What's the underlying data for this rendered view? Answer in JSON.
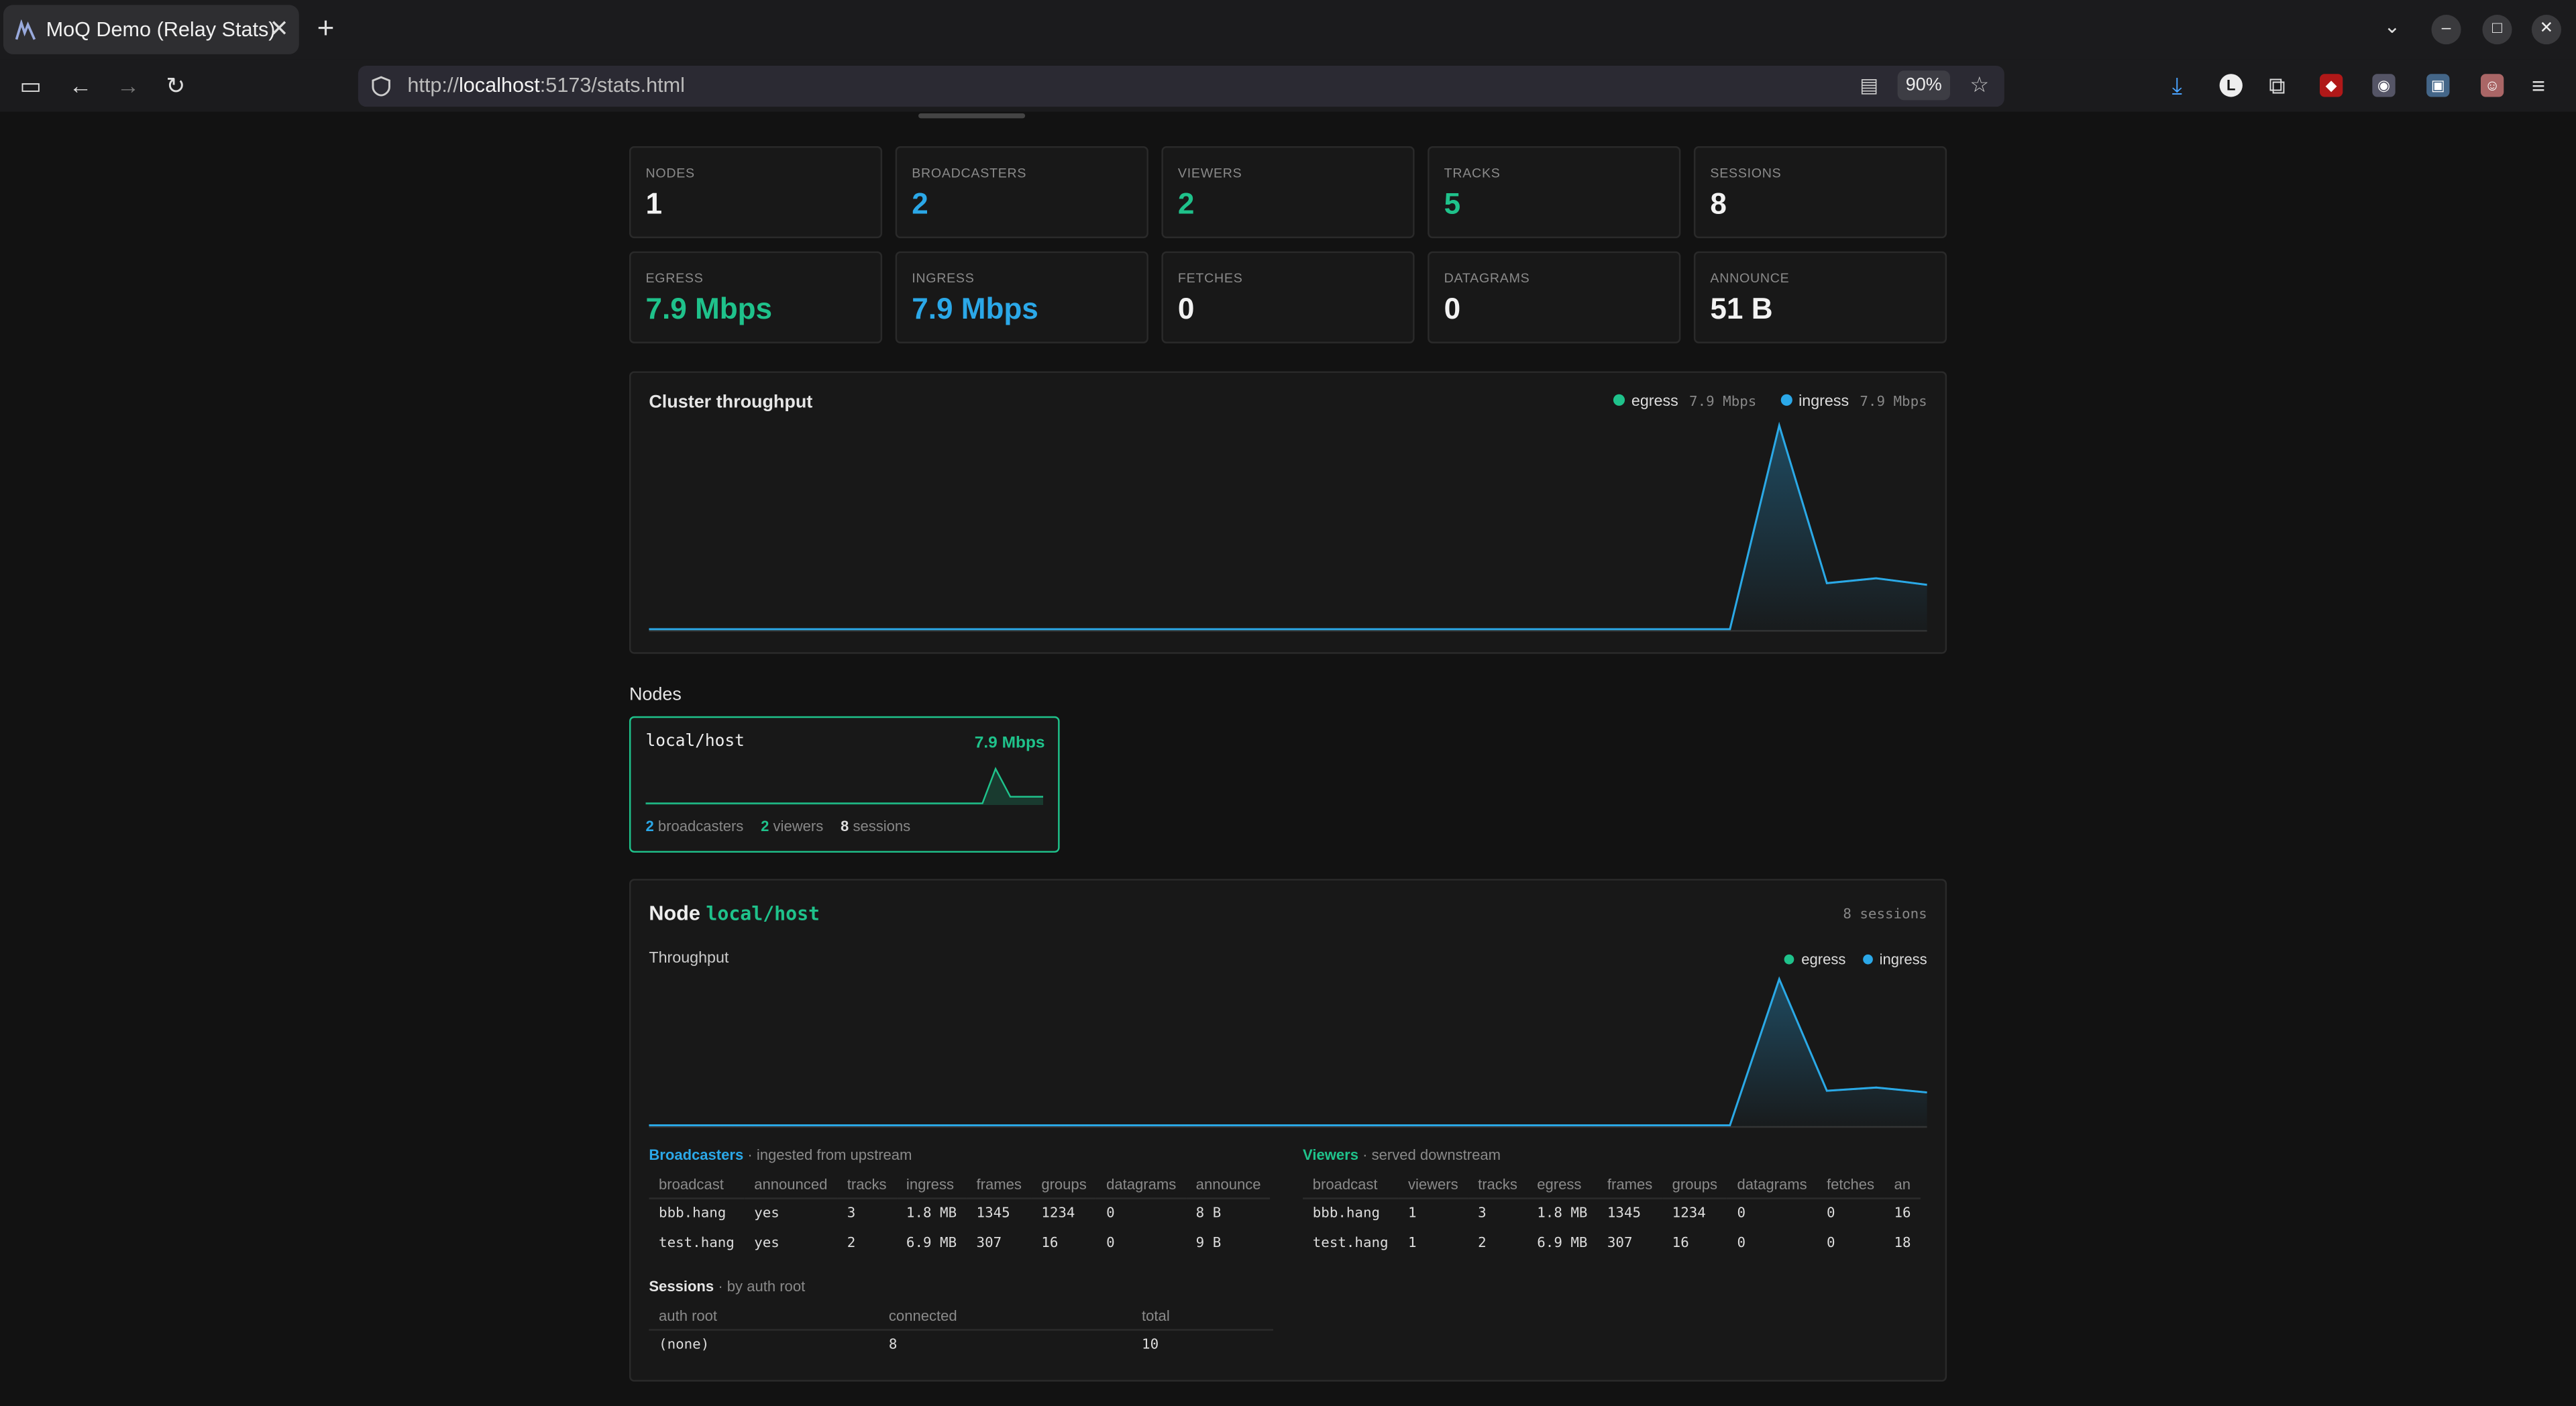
{
  "browser": {
    "tab_title": "MoQ Demo (Relay Stats)",
    "url_prefix": "http://",
    "url_host": "localhost",
    "url_rest": ":5173/stats.html",
    "zoom": "90%"
  },
  "stats_row1": [
    {
      "label": "NODES",
      "value": "1"
    },
    {
      "label": "BROADCASTERS",
      "value": "2"
    },
    {
      "label": "VIEWERS",
      "value": "2"
    },
    {
      "label": "TRACKS",
      "value": "5"
    },
    {
      "label": "SESSIONS",
      "value": "8"
    }
  ],
  "stats_row2": [
    {
      "label": "EGRESS",
      "value": "7.9 Mbps"
    },
    {
      "label": "INGRESS",
      "value": "7.9 Mbps"
    },
    {
      "label": "FETCHES",
      "value": "0"
    },
    {
      "label": "DATAGRAMS",
      "value": "0"
    },
    {
      "label": "ANNOUNCE",
      "value": "51 B"
    }
  ],
  "cluster": {
    "title": "Cluster throughput",
    "legend_egress": "egress",
    "egress_value": "7.9 Mbps",
    "legend_ingress": "ingress",
    "ingress_value": "7.9 Mbps"
  },
  "nodes_section": {
    "title": "Nodes",
    "node_name": "local/host",
    "node_rate": "7.9 Mbps",
    "broadcasters_count": "2",
    "broadcasters_label": "broadcasters",
    "viewers_count": "2",
    "viewers_label": "viewers",
    "sessions_count": "8",
    "sessions_label": "sessions"
  },
  "node_detail": {
    "title_prefix": "Node",
    "node_name": "local/host",
    "sessions_summary": "8 sessions",
    "throughput_label": "Throughput",
    "legend_egress": "egress",
    "legend_ingress": "ingress"
  },
  "broadcasters": {
    "title": "Broadcasters",
    "subtitle": "· ingested from upstream",
    "columns": [
      "broadcast",
      "announced",
      "tracks",
      "ingress",
      "frames",
      "groups",
      "datagrams",
      "announce"
    ],
    "rows": [
      [
        "bbb.hang",
        "yes",
        "3",
        "1.8 MB",
        "1345",
        "1234",
        "0",
        "8 B"
      ],
      [
        "test.hang",
        "yes",
        "2",
        "6.9 MB",
        "307",
        "16",
        "0",
        "9 B"
      ]
    ]
  },
  "viewers": {
    "title": "Viewers",
    "subtitle": "· served downstream",
    "columns": [
      "broadcast",
      "viewers",
      "tracks",
      "egress",
      "frames",
      "groups",
      "datagrams",
      "fetches",
      "an"
    ],
    "rows": [
      [
        "bbb.hang",
        "1",
        "3",
        "1.8 MB",
        "1345",
        "1234",
        "0",
        "0",
        "16"
      ],
      [
        "test.hang",
        "1",
        "2",
        "6.9 MB",
        "307",
        "16",
        "0",
        "0",
        "18"
      ]
    ]
  },
  "sessions": {
    "title": "Sessions",
    "subtitle": "· by auth root",
    "columns": [
      "auth root",
      "connected",
      "total"
    ],
    "rows": [
      [
        "(none)",
        "8",
        "10"
      ]
    ]
  },
  "colors": {
    "egress": "#1fc28b",
    "ingress": "#2ba8e8",
    "background": "#121212",
    "card": "#181818"
  }
}
